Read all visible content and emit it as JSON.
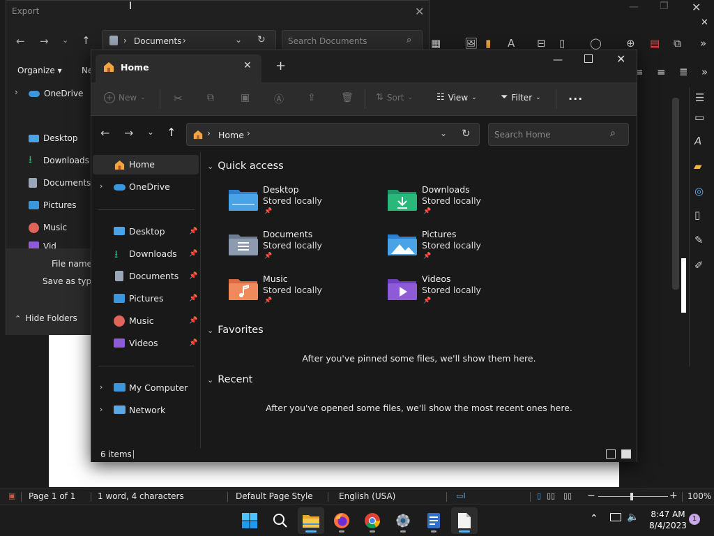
{
  "colors": {
    "accent": "#5fb2f2",
    "folder_blue": "#4aa3e6",
    "folder_green": "#2ab77a",
    "folder_purple": "#8e5bd8",
    "folder_orange": "#f08a5d",
    "folder_gray": "#8c9bb0",
    "pin_gray": "#b8b8b8"
  },
  "export_dialog": {
    "title": "Export",
    "breadcrumb": "Documents",
    "search_placeholder": "Search Documents",
    "organize_label": "Organize",
    "new_folder_label": "Ne",
    "nav": [
      {
        "label": "OneDrive",
        "icon": "cloud-icon"
      },
      {
        "label": "Desktop",
        "icon": "desktop-icon"
      },
      {
        "label": "Downloads",
        "icon": "download-icon"
      },
      {
        "label": "Documents",
        "icon": "document-icon"
      },
      {
        "label": "Pictures",
        "icon": "pictures-icon"
      },
      {
        "label": "Music",
        "icon": "music-icon"
      },
      {
        "label": "Vid",
        "icon": "videos-icon"
      }
    ],
    "file_name_label": "File name:",
    "save_as_type_label": "Save as type:",
    "hide_folders_label": "Hide Folders"
  },
  "explorer": {
    "tab_title": "Home",
    "toolbar": {
      "new_label": "New",
      "sort_label": "Sort",
      "view_label": "View",
      "filter_label": "Filter",
      "more_label": "..."
    },
    "breadcrumb": "Home",
    "search_placeholder": "Search Home",
    "nav": {
      "home": "Home",
      "onedrive": "OneDrive",
      "pinned": [
        {
          "label": "Desktop",
          "icon": "desktop-icon"
        },
        {
          "label": "Downloads",
          "icon": "download-icon"
        },
        {
          "label": "Documents",
          "icon": "document-icon"
        },
        {
          "label": "Pictures",
          "icon": "pictures-icon"
        },
        {
          "label": "Music",
          "icon": "music-icon"
        },
        {
          "label": "Videos",
          "icon": "videos-icon"
        }
      ],
      "my_computer": "My Computer",
      "network": "Network"
    },
    "quick_access": {
      "title": "Quick access",
      "items": [
        {
          "name": "Desktop",
          "subtitle": "Stored locally",
          "icon": "desktop-folder-icon"
        },
        {
          "name": "Downloads",
          "subtitle": "Stored locally",
          "icon": "downloads-folder-icon"
        },
        {
          "name": "Documents",
          "subtitle": "Stored locally",
          "icon": "documents-folder-icon"
        },
        {
          "name": "Pictures",
          "subtitle": "Stored locally",
          "icon": "pictures-folder-icon"
        },
        {
          "name": "Music",
          "subtitle": "Stored locally",
          "icon": "music-folder-icon"
        },
        {
          "name": "Videos",
          "subtitle": "Stored locally",
          "icon": "videos-folder-icon"
        }
      ]
    },
    "favorites": {
      "title": "Favorites",
      "empty_message": "After you've pinned some files, we'll show them here."
    },
    "recent": {
      "title": "Recent",
      "empty_message": "After you've opened some files, we'll show the most recent ones here."
    },
    "status": {
      "item_count": "6 items"
    }
  },
  "writer_status": {
    "page": "Page 1 of 1",
    "words": "1 word, 4 characters",
    "page_style": "Default Page Style",
    "language": "English (USA)",
    "zoom": "100%"
  },
  "taskbar": {
    "apps": [
      "start-icon",
      "search-icon",
      "file-explorer-icon",
      "firefox-icon",
      "chrome-icon",
      "settings-icon",
      "writer-app-icon",
      "libreoffice-icon"
    ],
    "time": "8:47 AM",
    "date": "8/4/2023",
    "notification_count": "1"
  }
}
